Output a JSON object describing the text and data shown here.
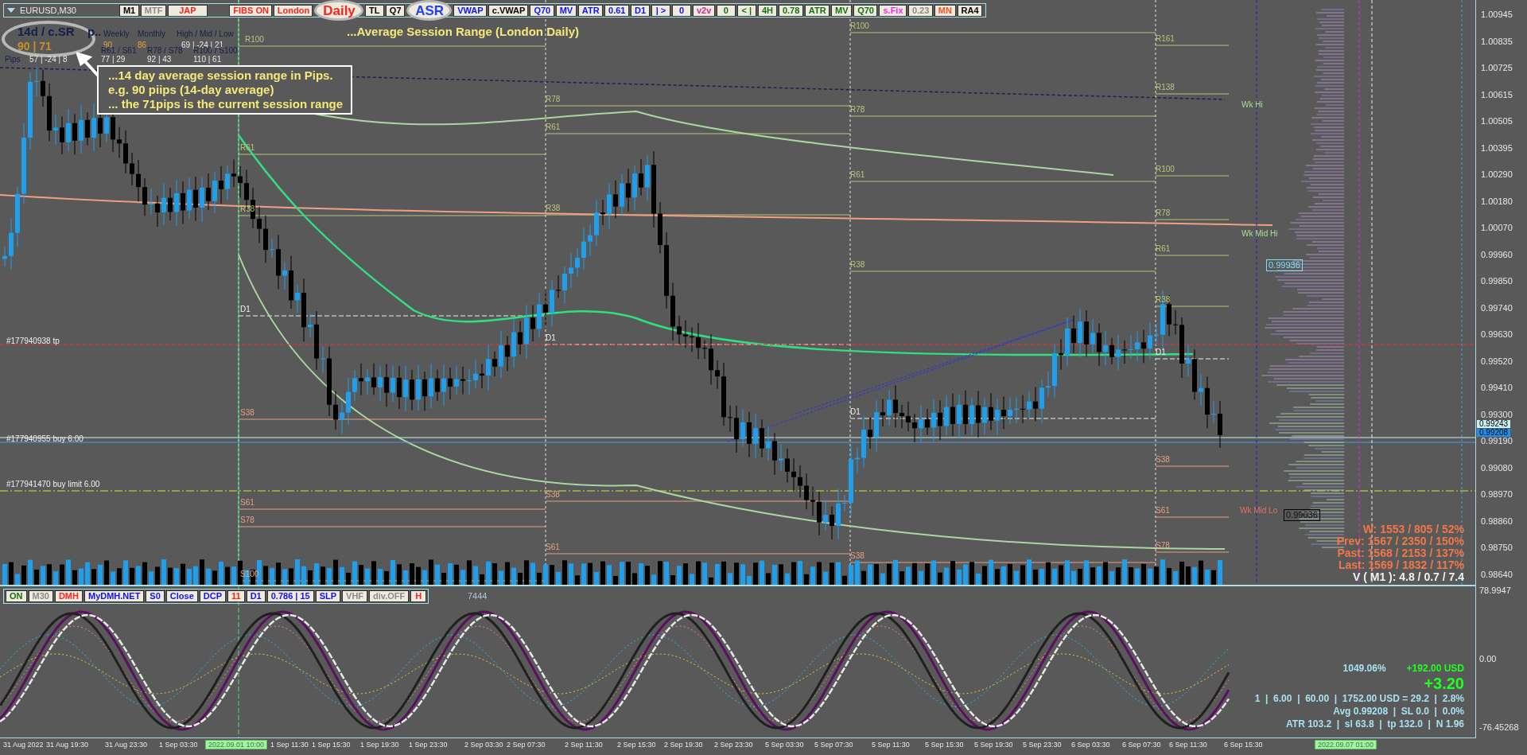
{
  "window": {
    "title": "EURUSD,M30"
  },
  "toolbar": {
    "buttons": [
      {
        "label": "M1",
        "color": "#000000",
        "kind": "plain"
      },
      {
        "label": "MTF",
        "color": "#8a8a8a",
        "kind": "plain"
      },
      {
        "label": "JAP",
        "color": "#ff2020",
        "kind": "wide"
      },
      {
        "label": "FIBS ON",
        "color": "#ff2020",
        "kind": "plain"
      },
      {
        "label": "London",
        "color": "#ff2020",
        "kind": "plain"
      },
      {
        "label": "Daily",
        "color": "#ff2020",
        "kind": "circled"
      },
      {
        "label": "TL",
        "color": "#000000",
        "kind": "plain"
      },
      {
        "label": "Q7",
        "color": "#000000",
        "kind": "plain"
      },
      {
        "label": "ASR",
        "color": "#2040ff",
        "kind": "circled"
      },
      {
        "label": "VWAP",
        "color": "#1010ff",
        "kind": "plain"
      },
      {
        "label": "c.VWAP",
        "color": "#000000",
        "kind": "plain"
      },
      {
        "label": "Q70",
        "color": "#1010ff",
        "kind": "plain"
      },
      {
        "label": "MV",
        "color": "#1010ff",
        "kind": "plain"
      },
      {
        "label": "ATR",
        "color": "#1010ff",
        "kind": "plain"
      },
      {
        "label": "0.61",
        "color": "#1010ff",
        "kind": "plain"
      },
      {
        "label": "D1",
        "color": "#1010ff",
        "kind": "plain"
      },
      {
        "label": "| >",
        "color": "#1010ff",
        "kind": "plain"
      },
      {
        "label": "0",
        "color": "#1010ff",
        "kind": "plain"
      },
      {
        "label": "v2v",
        "color": "#e020a0",
        "kind": "plain"
      },
      {
        "label": "0",
        "color": "#107010",
        "kind": "plain"
      },
      {
        "label": "< |",
        "color": "#107010",
        "kind": "plain"
      },
      {
        "label": "4H",
        "color": "#107010",
        "kind": "plain"
      },
      {
        "label": "0.78",
        "color": "#107010",
        "kind": "plain"
      },
      {
        "label": "ATR",
        "color": "#107010",
        "kind": "plain"
      },
      {
        "label": "MV",
        "color": "#107010",
        "kind": "plain"
      },
      {
        "label": "Q70",
        "color": "#107010",
        "kind": "plain"
      },
      {
        "label": "s.Fix",
        "color": "#ff20ff",
        "kind": "plain"
      },
      {
        "label": "0.23",
        "color": "#8a8a8a",
        "kind": "plain"
      },
      {
        "label": "MN",
        "color": "#ff5020",
        "kind": "plain"
      },
      {
        "label": "RA4",
        "color": "#000000",
        "kind": "plain"
      }
    ]
  },
  "chart_title": "...Average Session Range (London Daily)",
  "info_panel": {
    "title": "14d / c.SR",
    "values": "90 | 71",
    "cut_label": "p..",
    "columns": [
      {
        "label": "Weekly",
        "value": "90"
      },
      {
        "label": "Monthly",
        "value": "86"
      },
      {
        "label": "High / Mid / Low",
        "value": "69 | -24 | 21"
      }
    ],
    "pips_label": "Pips",
    "pips_value": "57 | -24 | 8",
    "fibs": [
      {
        "label": "R61 / S61",
        "value": "77 | 29"
      },
      {
        "label": "R78 / S78",
        "value": "92 | 43"
      },
      {
        "label": "R100 / S100",
        "value": "110 | 61"
      }
    ]
  },
  "annotation": {
    "lines": [
      "...14 day average session range in Pips.",
      "e.g. 90 piips (14-day average)",
      "... the 71pips  is the current session range"
    ]
  },
  "level_labels": [
    {
      "text": "R100"
    },
    {
      "text": "R61"
    },
    {
      "text": "R38"
    },
    {
      "text": "D1"
    },
    {
      "text": "S38"
    },
    {
      "text": "S61"
    },
    {
      "text": "S78"
    },
    {
      "text": "S100"
    },
    {
      "text": "R78"
    },
    {
      "text": "R61"
    },
    {
      "text": "R38"
    },
    {
      "text": "D1"
    },
    {
      "text": "S38"
    },
    {
      "text": "S61"
    },
    {
      "text": "R100"
    },
    {
      "text": "R78"
    },
    {
      "text": "R61"
    },
    {
      "text": "R38"
    },
    {
      "text": "D1"
    },
    {
      "text": "S38"
    },
    {
      "text": "R161"
    },
    {
      "text": "R138"
    },
    {
      "text": "R100"
    },
    {
      "text": "R78"
    },
    {
      "text": "R61"
    },
    {
      "text": "R38"
    },
    {
      "text": "D1"
    },
    {
      "text": "S38"
    },
    {
      "text": "S61"
    },
    {
      "text": "S78"
    },
    {
      "text": "Wk Hi"
    },
    {
      "text": "Wk Mid Hi"
    },
    {
      "text": "Wk Mid Lo"
    }
  ],
  "order_labels": [
    "#177940938 tp",
    "#177940955 buy 6.00",
    "#177941470 buy limit 6.00"
  ],
  "price_tags": [
    {
      "text": "0.99936",
      "kind": "cyan"
    },
    {
      "text": "0.99036",
      "kind": "dark"
    }
  ],
  "stats": {
    "lines": [
      "W: 1553 / 805 / 52%",
      "Prev: 1567 / 2350 / 150%",
      "Past: 1568 / 2153 / 137%",
      "Last: 1569 / 1832 / 117%"
    ],
    "volume": "V ( M1 ): 4.8 / 0.7 / 7.4"
  },
  "price_axis": {
    "labels": [
      "1.00945",
      "1.00835",
      "1.00725",
      "1.00615",
      "1.00505",
      "1.00395",
      "1.00290",
      "1.00180",
      "1.00070",
      "0.99960",
      "0.99850",
      "0.99740",
      "0.99630",
      "0.99520",
      "0.99410",
      "0.99300",
      "0.99190",
      "0.99080",
      "0.98970",
      "0.98860",
      "0.98750",
      "0.98640"
    ],
    "markers": [
      {
        "text": "0.99243",
        "kind": "bid"
      },
      {
        "text": "0.99208",
        "kind": "avg"
      }
    ]
  },
  "indicator_toolbar": {
    "buttons": [
      {
        "label": "ON",
        "color": "#107010"
      },
      {
        "label": "M30",
        "color": "#8a8a8a"
      },
      {
        "label": "DMH",
        "color": "#ff2020"
      },
      {
        "label": "MyDMH.NET",
        "color": "#1010ff"
      },
      {
        "label": "S0",
        "color": "#1010ff"
      },
      {
        "label": "Close",
        "color": "#1010ff"
      },
      {
        "label": "DCP",
        "color": "#1010ff"
      },
      {
        "label": "11",
        "color": "#ff2020"
      },
      {
        "label": "D1",
        "color": "#1010ff"
      },
      {
        "label": "0.786 | 15",
        "color": "#1010ff"
      },
      {
        "label": "SLP",
        "color": "#1010ff"
      },
      {
        "label": "VHF",
        "color": "#8a8a8a"
      },
      {
        "label": "div.OFF",
        "color": "#8a8a8a"
      },
      {
        "label": "H",
        "color": "#ff2020"
      }
    ],
    "note": "7444"
  },
  "indicator_axis": {
    "labels": [
      "78.9947",
      "0.00",
      "-76.45268"
    ]
  },
  "account": {
    "percent": "1049.06%",
    "profit": "+192.00 USD",
    "pips": "+3.20",
    "lines": [
      "1  |  6.00  |  60.00  |  1752.00 USD = 29.2  |  2.8%",
      "Avg 0.99208  |  SL 0.0  |  0.0%",
      "ATR 103.2  |  sl 63.8  |  tp 132.0  |  N 1.96"
    ]
  },
  "time_axis": {
    "labels": [
      {
        "text": "31 Aug 2022",
        "kind": "tick"
      },
      {
        "text": "31 Aug 19:30",
        "kind": "tick"
      },
      {
        "text": "31 Aug 23:30",
        "kind": "tick"
      },
      {
        "text": "1 Sep 03:30",
        "kind": "tick"
      },
      {
        "text": "2022.09.01 10:00",
        "kind": "cursor"
      },
      {
        "text": "1 Sep 11:30",
        "kind": "tick"
      },
      {
        "text": "1 Sep 15:30",
        "kind": "tick"
      },
      {
        "text": "1 Sep 19:30",
        "kind": "tick"
      },
      {
        "text": "1 Sep 23:30",
        "kind": "tick"
      },
      {
        "text": "2 Sep 03:30",
        "kind": "tick"
      },
      {
        "text": "2 Sep 07:30",
        "kind": "tick"
      },
      {
        "text": "2 Sep 11:30",
        "kind": "tick"
      },
      {
        "text": "2 Sep 15:30",
        "kind": "tick"
      },
      {
        "text": "2 Sep 19:30",
        "kind": "tick"
      },
      {
        "text": "2 Sep 23:30",
        "kind": "tick"
      },
      {
        "text": "5 Sep 03:30",
        "kind": "tick"
      },
      {
        "text": "5 Sep 07:30",
        "kind": "tick"
      },
      {
        "text": "5 Sep 11:30",
        "kind": "tick"
      },
      {
        "text": "5 Sep 15:30",
        "kind": "tick"
      },
      {
        "text": "5 Sep 19:30",
        "kind": "tick"
      },
      {
        "text": "5 Sep 23:30",
        "kind": "tick"
      },
      {
        "text": "6 Sep 03:30",
        "kind": "tick"
      },
      {
        "text": "6 Sep 07:30",
        "kind": "tick"
      },
      {
        "text": "6 Sep 11:30",
        "kind": "tick"
      },
      {
        "text": "6 Sep 15:30",
        "kind": "tick"
      },
      {
        "text": "2022.09.07 01:00",
        "kind": "cursor"
      }
    ]
  }
}
